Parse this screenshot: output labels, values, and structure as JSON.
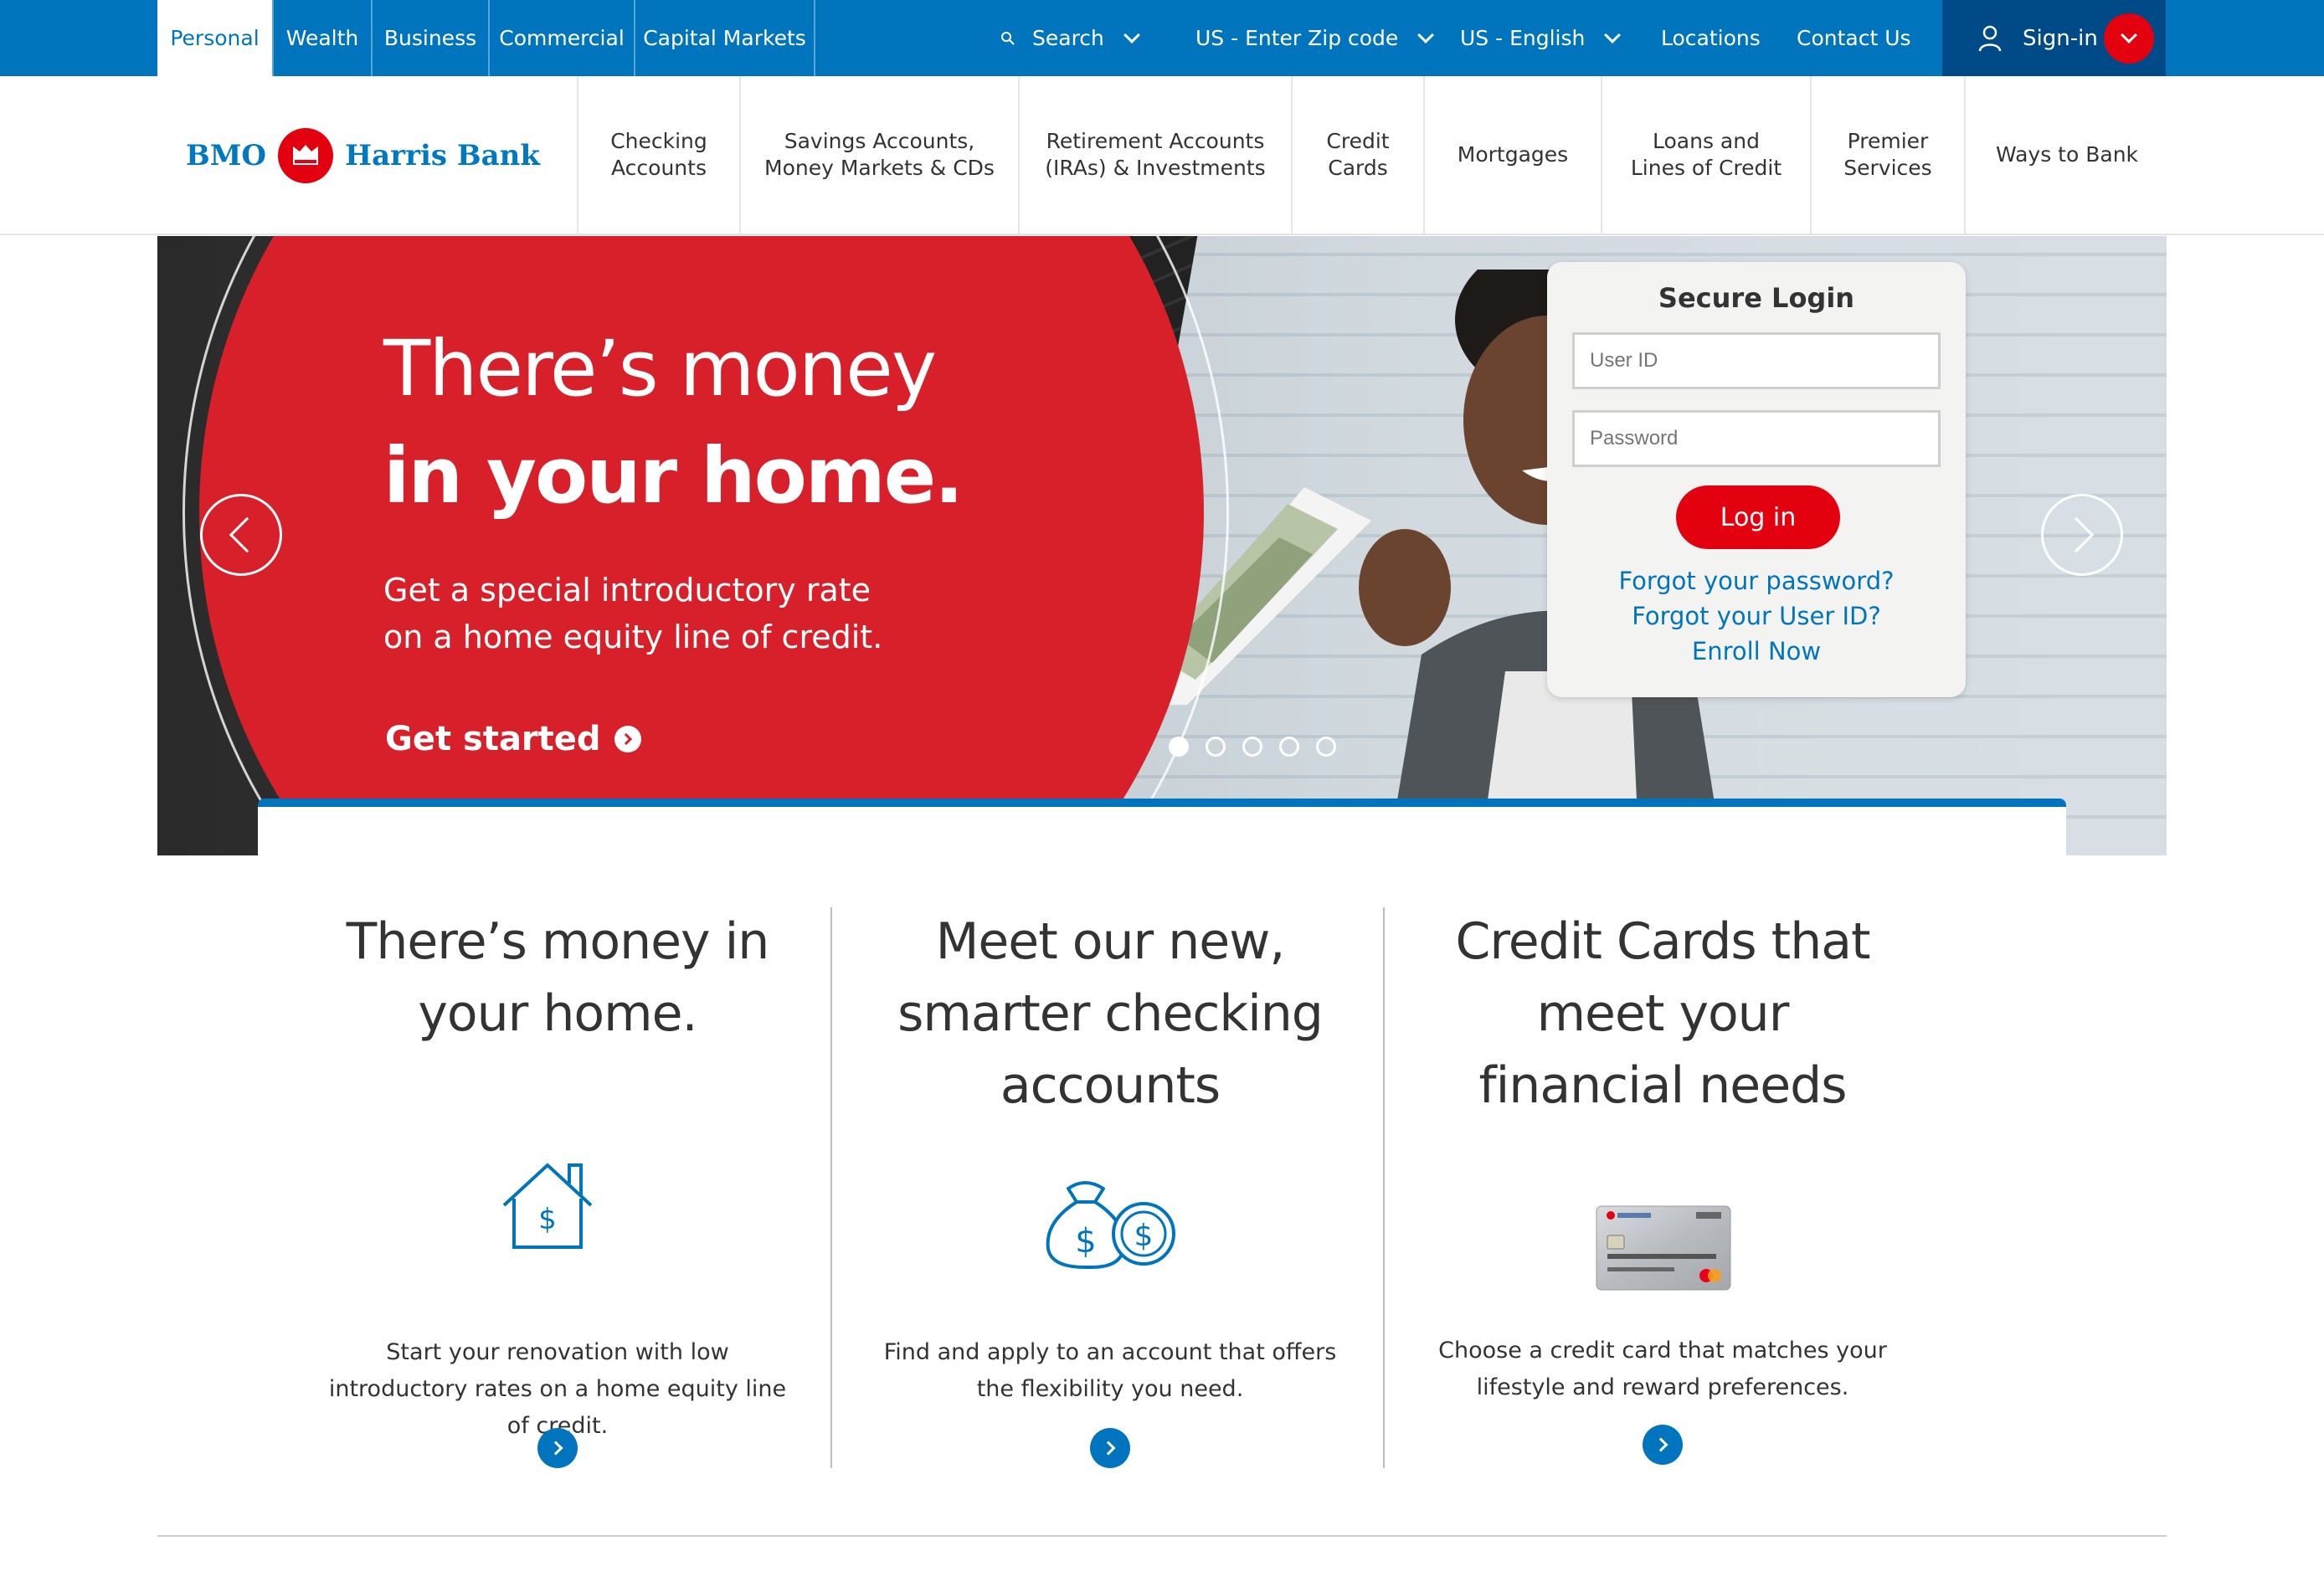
{
  "segments": {
    "personal": "Personal",
    "wealth": "Wealth",
    "business": "Business",
    "commercial": "Commercial",
    "capital_markets": "Capital Markets"
  },
  "utility": {
    "search": "Search",
    "zip": "US - Enter Zip code",
    "language": "US - English",
    "locations": "Locations",
    "contact": "Contact Us",
    "signin": "Sign-in"
  },
  "brand": {
    "left": "BMO",
    "right": "Harris Bank",
    "color": "#0079c1",
    "accent": "#e3000f",
    "primary_blue": "#0075be"
  },
  "nav": {
    "checking": "Checking\nAccounts",
    "savings": "Savings Accounts,\nMoney Markets & CDs",
    "retirement": "Retirement Accounts\n(IRAs) & Investments",
    "credit": "Credit\nCards",
    "mortgages": "Mortgages",
    "loans": "Loans and\nLines of Credit",
    "premier": "Premier\nServices",
    "ways": "Ways to Bank"
  },
  "hero": {
    "line1": "There’s money",
    "line2": "in your home.",
    "sub": "Get a special introductory rate on a home equity line of credit.",
    "cta": "Get started",
    "slides": 5,
    "active_slide": 1
  },
  "login": {
    "title": "Secure Login",
    "user_placeholder": "User ID",
    "password_placeholder": "Password",
    "button": "Log in",
    "forgot_password": "Forgot your password?",
    "forgot_userid": "Forgot your User ID?",
    "enroll": "Enroll Now"
  },
  "cards": [
    {
      "title": "There’s money in your home.",
      "icon": "house-dollar-icon",
      "text": "Start your renovation with low introductory rates on a home equity line of credit."
    },
    {
      "title": "Meet our new, smarter checking accounts",
      "icon": "money-bag-icon",
      "text": "Find and apply to an account that offers the flexibility you need."
    },
    {
      "title": "Credit Cards that meet your financial needs",
      "icon": "credit-card-image",
      "text": "Choose a credit card that matches your lifestyle and reward preferences."
    }
  ]
}
